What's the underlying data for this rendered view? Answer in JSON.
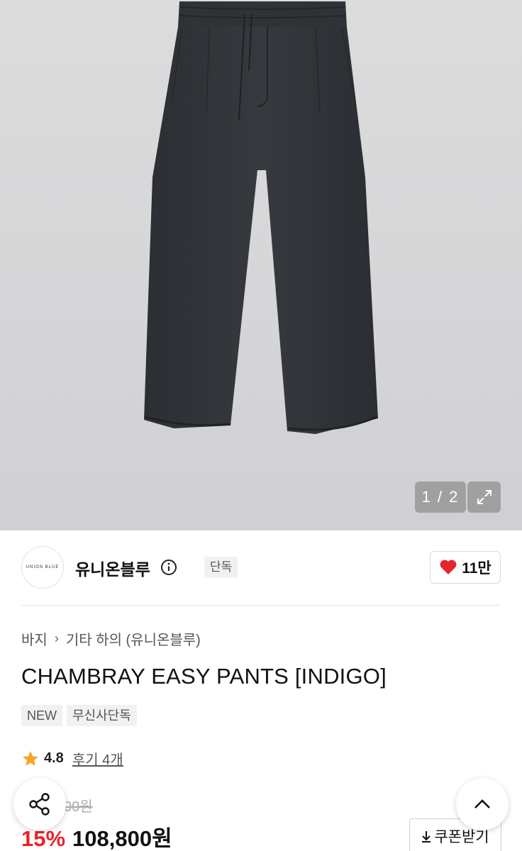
{
  "gallery": {
    "counter": "1 / 2"
  },
  "brand": {
    "logo_text": "UNION BLUE",
    "name": "유니온블루",
    "badge": "단독",
    "likes": "11만"
  },
  "breadcrumb": {
    "category": "바지",
    "subcategory": "기타 하의 (유니온블루)"
  },
  "product": {
    "title": "CHAMBRAY EASY PANTS [INDIGO]",
    "tags": [
      "NEW",
      "무신사단독"
    ],
    "rating": "4.8",
    "reviews": "후기 4개",
    "original_price": "00원",
    "discount": "15%",
    "price": "108,800원",
    "coupon_label": "쿠폰받기"
  },
  "colors": {
    "sale_red": "#e8242b",
    "heart_red": "#e8242b",
    "star": "#f5a623"
  },
  "icons": {
    "expand": "expand-icon",
    "info": "info-icon",
    "heart": "heart-icon",
    "star": "star-icon",
    "share": "share-icon",
    "scroll_top": "chevron-up-icon",
    "download": "download-icon"
  }
}
